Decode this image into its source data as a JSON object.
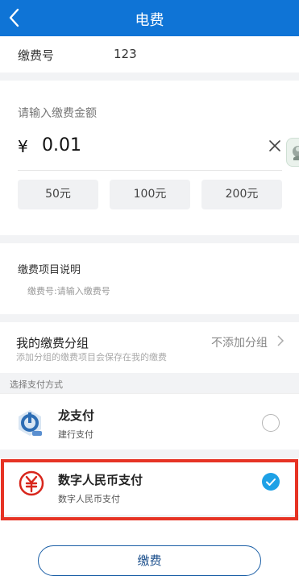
{
  "header": {
    "title": "电费"
  },
  "account": {
    "label": "缴费号",
    "value": "123"
  },
  "amount": {
    "label": "请输入缴费金额",
    "currency": "¥",
    "value": "0.01",
    "quick_amounts": [
      "50元",
      "100元",
      "200元"
    ]
  },
  "description": {
    "title": "缴费项目说明",
    "text": "缴费号:请输入缴费号"
  },
  "group": {
    "title": "我的缴费分组",
    "subtitle": "添加分组的缴费项目会保存在我的缴费",
    "value": "不添加分组"
  },
  "payment": {
    "section_label": "选择支付方式",
    "methods": [
      {
        "name": "龙支付",
        "sub": "建行支付",
        "selected": false
      },
      {
        "name": "数字人民币支付",
        "sub": "数字人民币支付",
        "selected": true
      }
    ]
  },
  "submit": {
    "label": "缴费"
  },
  "colors": {
    "header": "#0f74d6",
    "check": "#1ea1e6",
    "highlight": "#e63324"
  }
}
